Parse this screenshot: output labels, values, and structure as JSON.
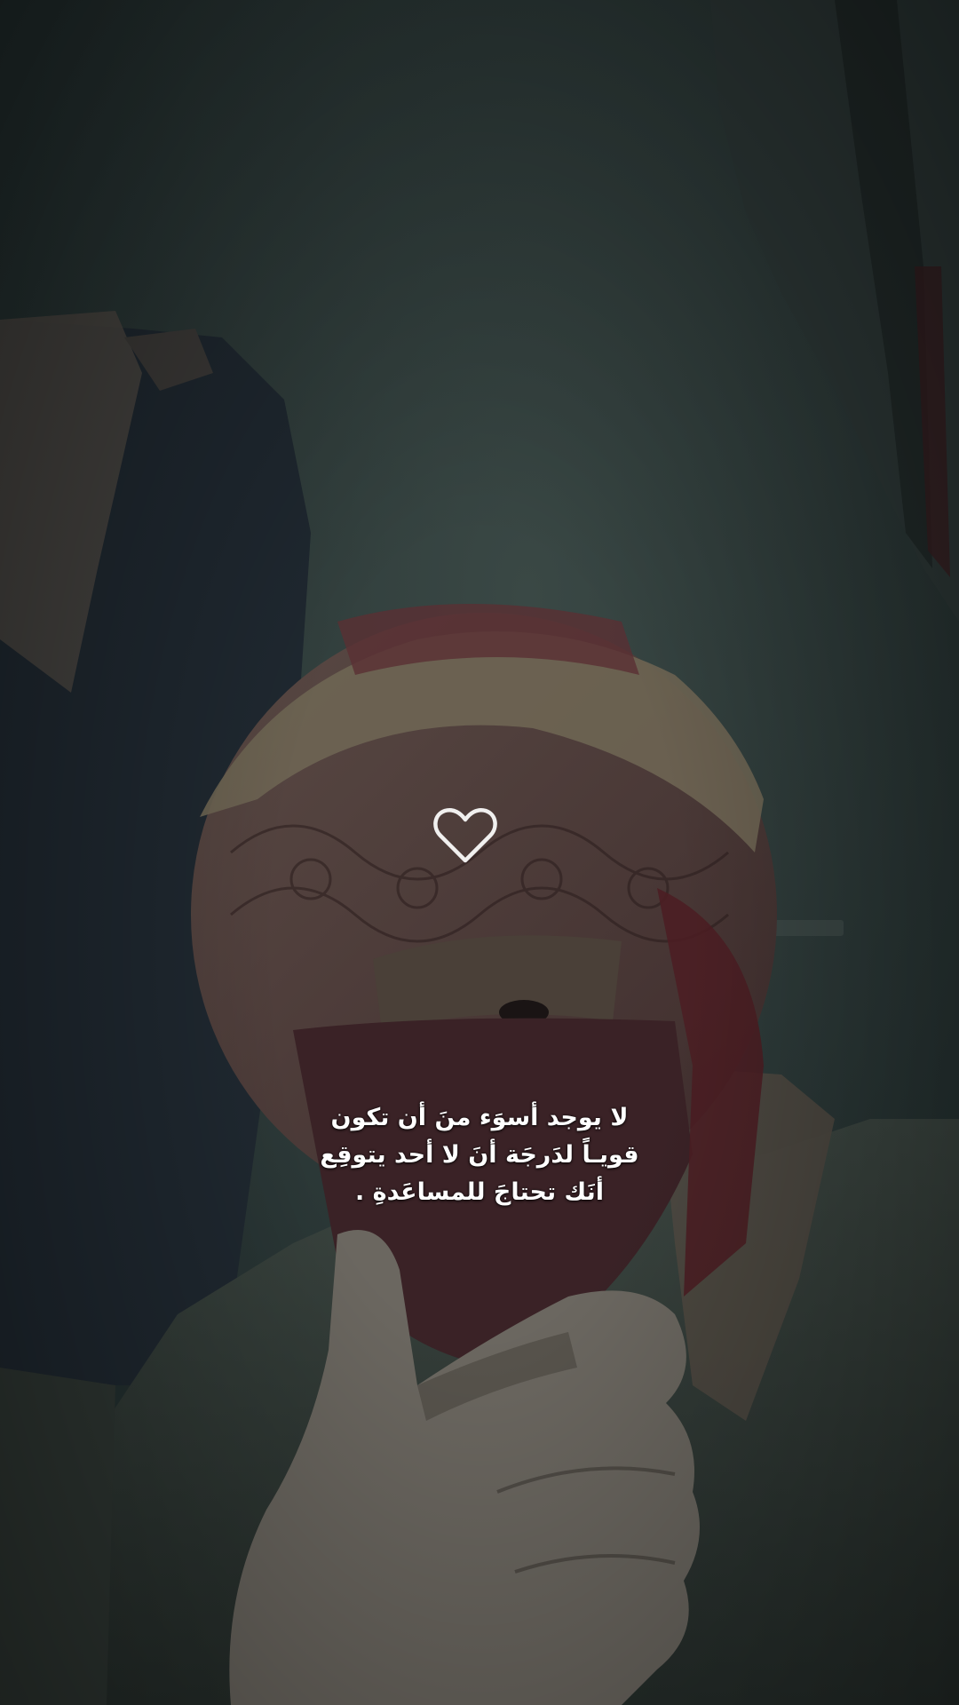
{
  "story": {
    "caption_lines": [
      "لا يوجد أسوَء منَ أن تكون",
      "قويـاً لدَرجَة أنَ لا أحد يتوقِع",
      "أنَك تحتاجَ للمساعَدةِ ."
    ],
    "sticker_icon": "heart-outline-icon",
    "colors": {
      "text": "#ffffff",
      "background_tint": "#2a3533"
    }
  }
}
